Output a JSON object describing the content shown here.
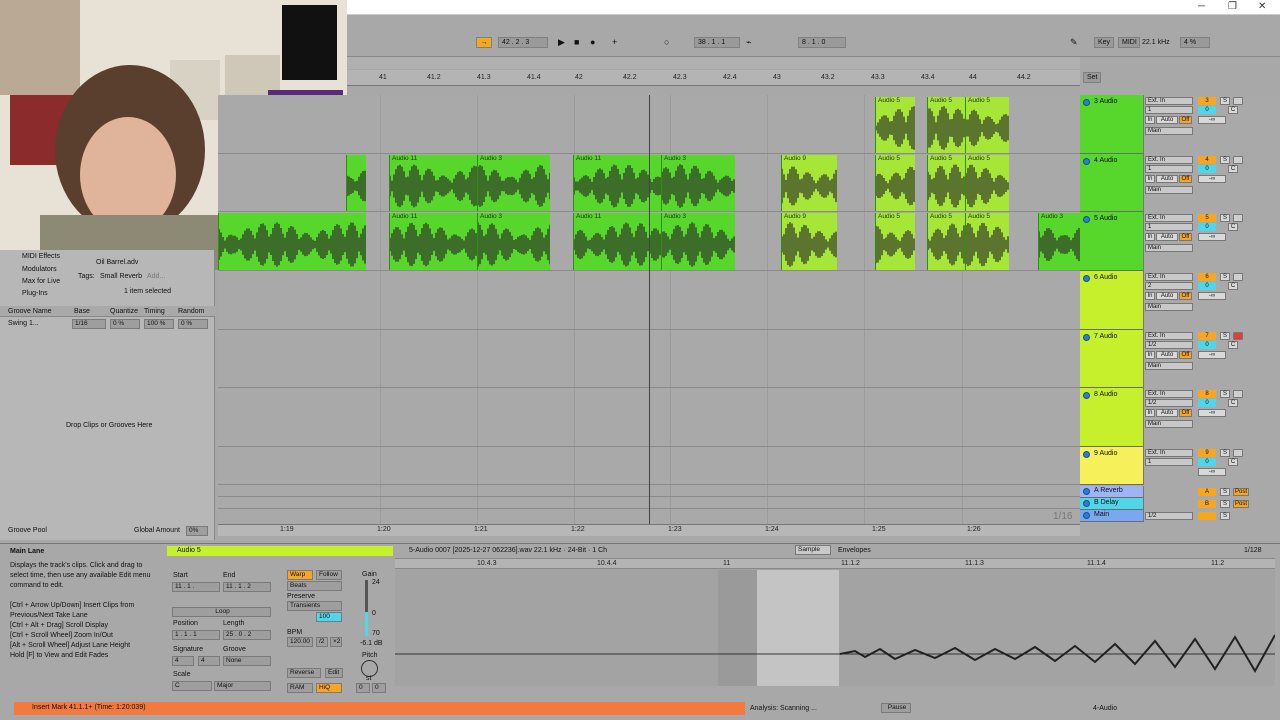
{
  "transport": {
    "arrangement_pos": "42 . 2 . 3",
    "loop_start": "38 . 1 . 1",
    "loop_length": "8 . 1 . 0",
    "key_label": "Key",
    "midi_label": "MIDI",
    "sample_rate": "22.1 kHz",
    "cpu": "4 %"
  },
  "ruler": {
    "bars": [
      "41",
      "41.2",
      "41.3",
      "41.4",
      "42",
      "42.2",
      "42.3",
      "42.4",
      "43",
      "43.2",
      "43.3",
      "43.4",
      "44",
      "44.2"
    ],
    "set_label": "Set"
  },
  "time_ruler": [
    "1:19",
    "1:20",
    "1:21",
    "1:22",
    "1:23",
    "1:24",
    "1:25",
    "1:26"
  ],
  "zoom_label": "1/16",
  "tracks": [
    {
      "name": "3 Audio",
      "input": "Ext. In",
      "channel": "1",
      "num": "3",
      "vol": "0",
      "color": "#57d62c",
      "routing": "Main"
    },
    {
      "name": "4 Audio",
      "input": "Ext. In",
      "channel": "1",
      "num": "4",
      "vol": "0",
      "color": "#57d62c",
      "routing": "Main"
    },
    {
      "name": "5 Audio",
      "input": "Ext. In",
      "channel": "1",
      "num": "5",
      "vol": "0",
      "color": "#57d62c",
      "routing": "Main"
    },
    {
      "name": "6 Audio",
      "input": "Ext. In",
      "channel": "2",
      "num": "6",
      "vol": "0",
      "color": "#c6f02c",
      "routing": "Main"
    },
    {
      "name": "7 Audio",
      "input": "Ext. In",
      "channel": "1/2",
      "num": "7",
      "vol": "0",
      "color": "#c6f02c",
      "routing": "Main"
    },
    {
      "name": "8 Audio",
      "input": "Ext. In",
      "channel": "1/2",
      "num": "8",
      "vol": "0",
      "color": "#c6f02c",
      "routing": "Main"
    },
    {
      "name": "9 Audio",
      "input": "Ext. In",
      "channel": "1",
      "num": "9",
      "vol": "0",
      "color": "#f6f05a",
      "routing": "Main"
    }
  ],
  "returns": [
    {
      "name": "A Reverb",
      "letter": "A",
      "color": "#9fb4f5"
    },
    {
      "name": "B Delay",
      "letter": "B",
      "color": "#4fd6e8"
    },
    {
      "name": "Main",
      "letter": "",
      "color": "#7aa8f0",
      "channel": "1/2"
    }
  ],
  "io_labels": {
    "in": "In",
    "auto": "Auto",
    "off": "Off",
    "s": "S",
    "c": "C",
    "post": "Post",
    "inf": "-∞"
  },
  "clips_row3": [
    "Audio 5",
    "Audio 5",
    "Audio 5"
  ],
  "clips_row4": [
    "Audio 11",
    "Audio 3",
    "Audio 11",
    "Audio 3",
    "Audio 9",
    "Audio 5",
    "Audio 5",
    "Audio 5"
  ],
  "clips_row5": [
    "Audio 11",
    "Audio 3",
    "Audio 11",
    "Audio 3",
    "Audio 9",
    "Audio 5",
    "Audio 5",
    "Audio 5",
    "Audio 3"
  ],
  "browser": {
    "items": [
      "MIDI Effects",
      "Modulators",
      "Max for Live",
      "Plug-Ins"
    ],
    "file": "Oil Barrel.adv",
    "tags_label": "Tags:",
    "tag": "Small Reverb",
    "add": "Add...",
    "selected": "1 item selected",
    "groove_headers": [
      "Groove Name",
      "Base",
      "Quantize",
      "Timing",
      "Random"
    ],
    "groove_row": {
      "name": "Swing 1...",
      "base": "1/16",
      "quantize": "0 %",
      "timing": "100 %",
      "random": "0 %"
    },
    "drop_hint": "Drop Clips or Grooves Here",
    "pool_label": "Groove Pool",
    "global_amount_label": "Global Amount",
    "global_amount": "0%"
  },
  "info": {
    "title": "Main Lane",
    "lines": [
      "Displays the track's clips. Click and drag to",
      "select time, then use any available Edit menu",
      "command to edit.",
      "",
      "[Ctrl + Arrow Up/Down] Insert Clips from",
      "Previous/Next Take Lane",
      "[Ctrl + Alt + Drag] Scroll Display",
      "[Ctrl + Scroll Wheel] Zoom In/Out",
      "[Alt + Scroll Wheel] Adjust Lane Height",
      "Hold [F] to View and Edit Fades"
    ]
  },
  "clip_view": {
    "clip_name": "Audio 5",
    "start_label": "Start",
    "end_label": "End",
    "set": "Set",
    "start_val": "11 . 1 .",
    "end_val": "11 . 1 . 2",
    "loop": "Loop",
    "position_label": "Position",
    "length_label": "Length",
    "position_val": "1 . 1 . 1",
    "length_val": "25 . 0 . 2",
    "signature_label": "Signature",
    "groove_label": "Groove",
    "sig_num": "4",
    "sig_den": "4",
    "groove_val": "None",
    "scale_label": "Scale",
    "scale_root": "C",
    "scale_mode": "Major",
    "warp": "Warp",
    "follow": "Follow",
    "warp_mode": "Beats",
    "preserve_label": "Preserve",
    "preserve_val": "Transients",
    "env_val": "100",
    "bpm_label": "BPM",
    "bpm_val": "120.00",
    "half": "/2",
    "double": "×2",
    "reverse": "Reverse",
    "edit": "Edit",
    "ram": "RAM",
    "hiq": "HiQ",
    "gain_label": "Gain",
    "gain_val": "-6.1 dB",
    "gain_max": "24",
    "gain_zero": "0",
    "gain_min": "70",
    "pitch_label": "Pitch",
    "pitch_unit": "st",
    "pitch_val": "0",
    "pitch_cents": "0",
    "file_info": "5-Audio 0007 [2025-12-27 062236].wav  22.1 kHz · 24-Bit · 1 Ch",
    "tab_sample": "Sample",
    "tab_envelopes": "Envelopes",
    "quant": "1/128",
    "wave_ticks": [
      "10.4.3",
      "10.4.4",
      "11",
      "11.1.2",
      "11.1.3",
      "11.1.4",
      "11.2"
    ]
  },
  "status": {
    "message": "Insert Mark 41.1.1+ (Time: 1:20:039)",
    "analysis": "Analysis: Scanning ...",
    "pause": "Pause",
    "track": "4-Audio"
  }
}
